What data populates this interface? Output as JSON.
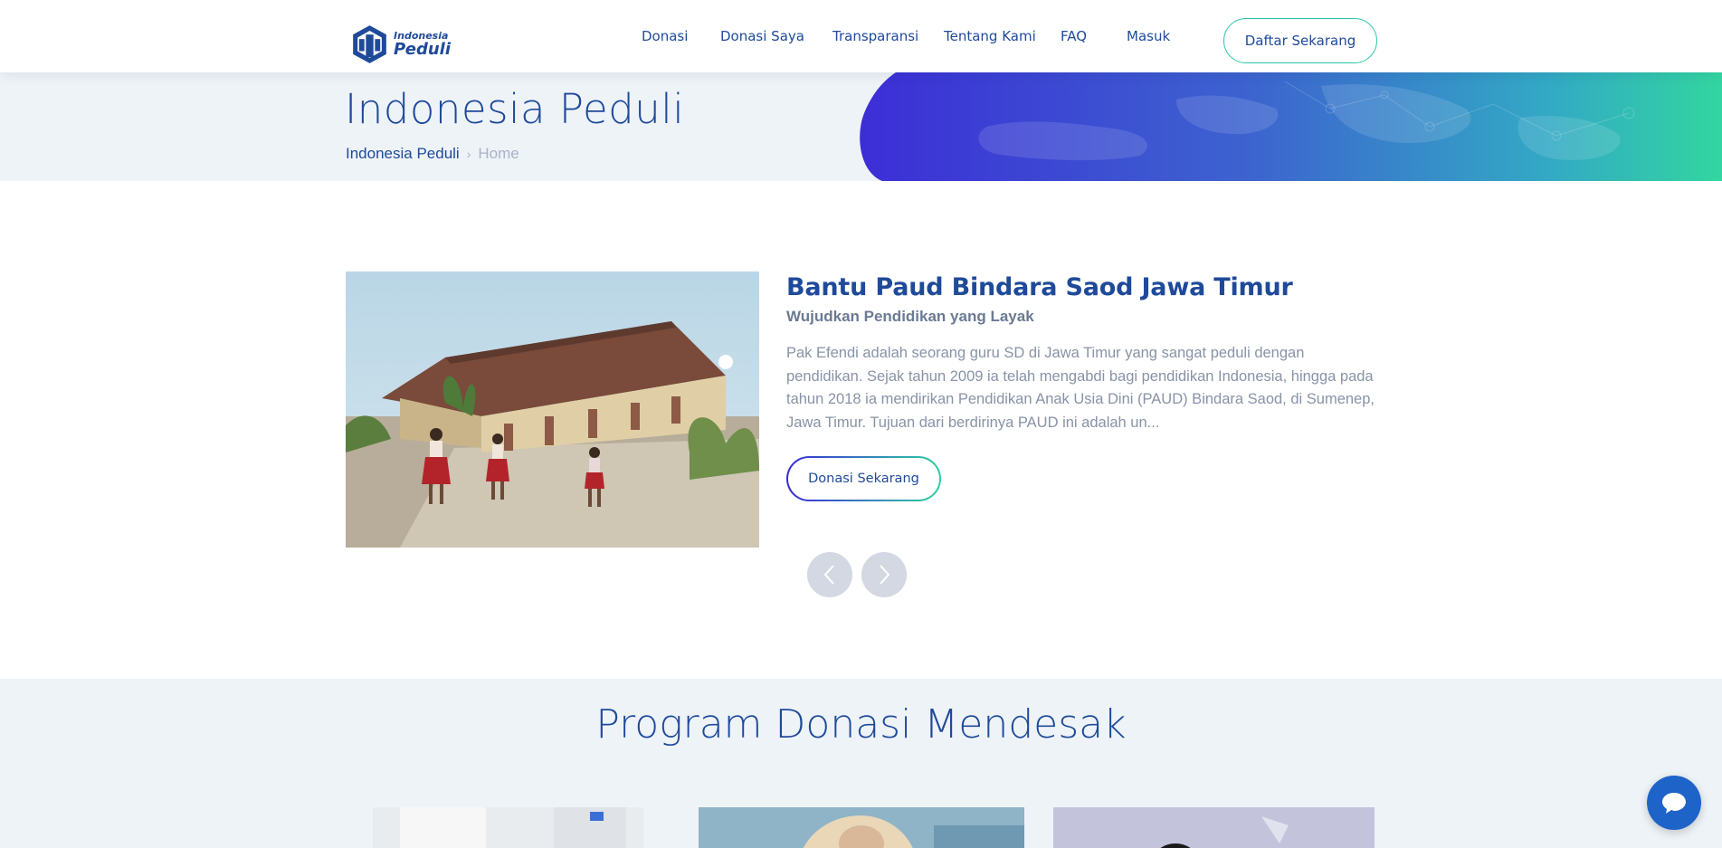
{
  "header": {
    "logo": {
      "line1": "Indonesia",
      "line2": "Peduli"
    },
    "nav": [
      {
        "label": "Donasi"
      },
      {
        "label": "Donasi Saya"
      },
      {
        "label": "Transparansi"
      },
      {
        "label": "Tentang Kami"
      },
      {
        "label": "FAQ"
      },
      {
        "label": "Masuk"
      }
    ],
    "cta_label": "Daftar Sekarang"
  },
  "hero": {
    "title": "Indonesia Peduli",
    "breadcrumb": {
      "link": "Indonesia Peduli",
      "separator": "›",
      "current": "Home"
    }
  },
  "feature": {
    "title": "Bantu Paud Bindara Saod Jawa Timur",
    "subtitle": "Wujudkan Pendidikan yang Layak",
    "description": "Pak Efendi adalah seorang guru SD di Jawa Timur yang sangat peduli dengan pendidikan. Sejak tahun 2009 ia telah mengabdi bagi pendidikan Indonesia, hingga pada tahun 2018 ia mendirikan Pendidikan Anak Usia Dini (PAUD) Bindara Saod, di Sumenep, Jawa Timur. Tujuan dari berdirinya PAUD ini adalah un...",
    "button_label": "Donasi Sekarang"
  },
  "carousel": {
    "prev_icon": "chevron-left-icon",
    "next_icon": "chevron-right-icon"
  },
  "program": {
    "title": "Program Donasi Mendesak"
  },
  "chat": {
    "icon": "chat-bubble-icon"
  },
  "colors": {
    "brand_blue": "#1f4a9a",
    "accent_teal": "#2cc6a8",
    "gradient_start": "#3a2bd8",
    "gradient_end": "#2fd0a2",
    "section_bg": "#eef3f8",
    "chat_blue": "#1e63c8"
  }
}
